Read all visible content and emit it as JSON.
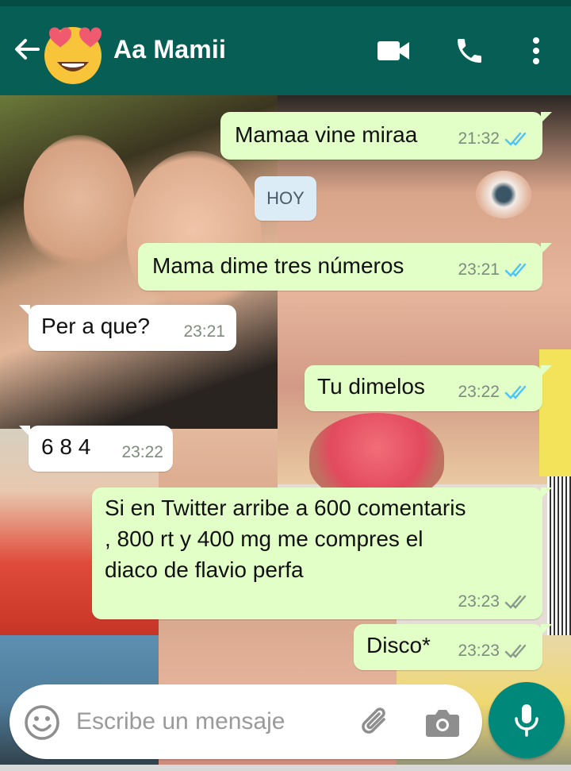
{
  "header": {
    "contact_name": "Aa Mamii",
    "avatar_icon": "heart-eyes-emoji-icon",
    "actions": [
      "video-call-icon",
      "phone-icon",
      "more-options-icon"
    ],
    "bg_color": "#075e54"
  },
  "day_label": "HOY",
  "messages": [
    {
      "direction": "out",
      "text": "Mamaa vine miraa",
      "time": "21:32",
      "status": "read"
    },
    {
      "direction": "out",
      "text": "Mama dime tres números",
      "time": "23:21",
      "status": "read"
    },
    {
      "direction": "in",
      "text": "Per a que?",
      "time": "23:21"
    },
    {
      "direction": "out",
      "text": "Tu dimelos",
      "time": "23:22",
      "status": "read"
    },
    {
      "direction": "in",
      "text": "6 8 4",
      "time": "23:22"
    },
    {
      "direction": "out",
      "text": "Si en Twitter arribe a 600 comentaris , 800 rt y 400 mg me compres el diaco de flavio perfa",
      "time": "23:23",
      "status": "delivered"
    },
    {
      "direction": "out",
      "text": "Disco*",
      "time": "23:23",
      "status": "delivered"
    }
  ],
  "composer": {
    "placeholder": "Escribe un mensaje",
    "value": "",
    "icons": [
      "emoji-icon",
      "attach-icon",
      "camera-icon",
      "mic-icon"
    ]
  },
  "colors": {
    "outgoing_bubble": "#e1ffc7",
    "incoming_bubble": "#ffffff",
    "read_ticks": "#4fc3f7",
    "delivered_ticks": "#8a9a8a",
    "mic_button": "#00897b"
  }
}
